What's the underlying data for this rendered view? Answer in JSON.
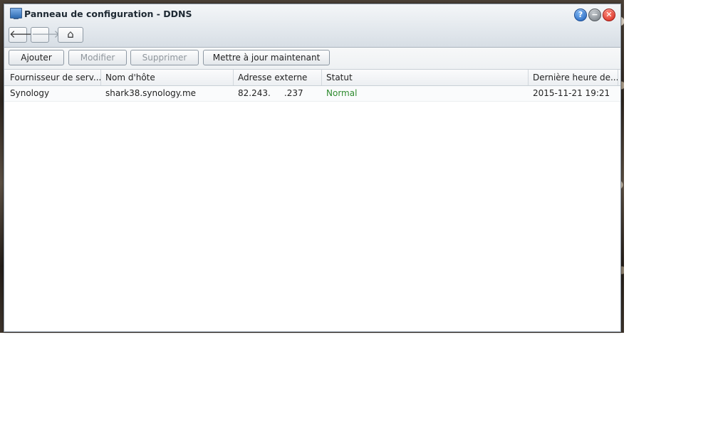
{
  "window": {
    "title": "Panneau de configuration - DDNS",
    "controls": {
      "help": "?",
      "minimize": "−",
      "close": "✕"
    }
  },
  "nav": {
    "back": "🡐",
    "forward": "🡒",
    "home": "⌂"
  },
  "toolbar": {
    "add_label": "Ajouter",
    "edit_label": "Modifier",
    "delete_label": "Supprimer",
    "update_label": "Mettre à jour maintenant"
  },
  "table": {
    "columns": [
      "Fournisseur de serv...",
      "Nom d'hôte",
      "Adresse externe",
      "Statut",
      "Dernière heure de..."
    ],
    "rows": [
      {
        "provider": "Synology",
        "hostname": "shark38.synology.me",
        "address": "82.243.     .237",
        "status": "Normal",
        "last_update": "2015-11-21 19:21"
      }
    ]
  },
  "colors": {
    "status_normal": "#2e8b2e",
    "accent": "#1f5fb8",
    "close": "#d2231a"
  }
}
